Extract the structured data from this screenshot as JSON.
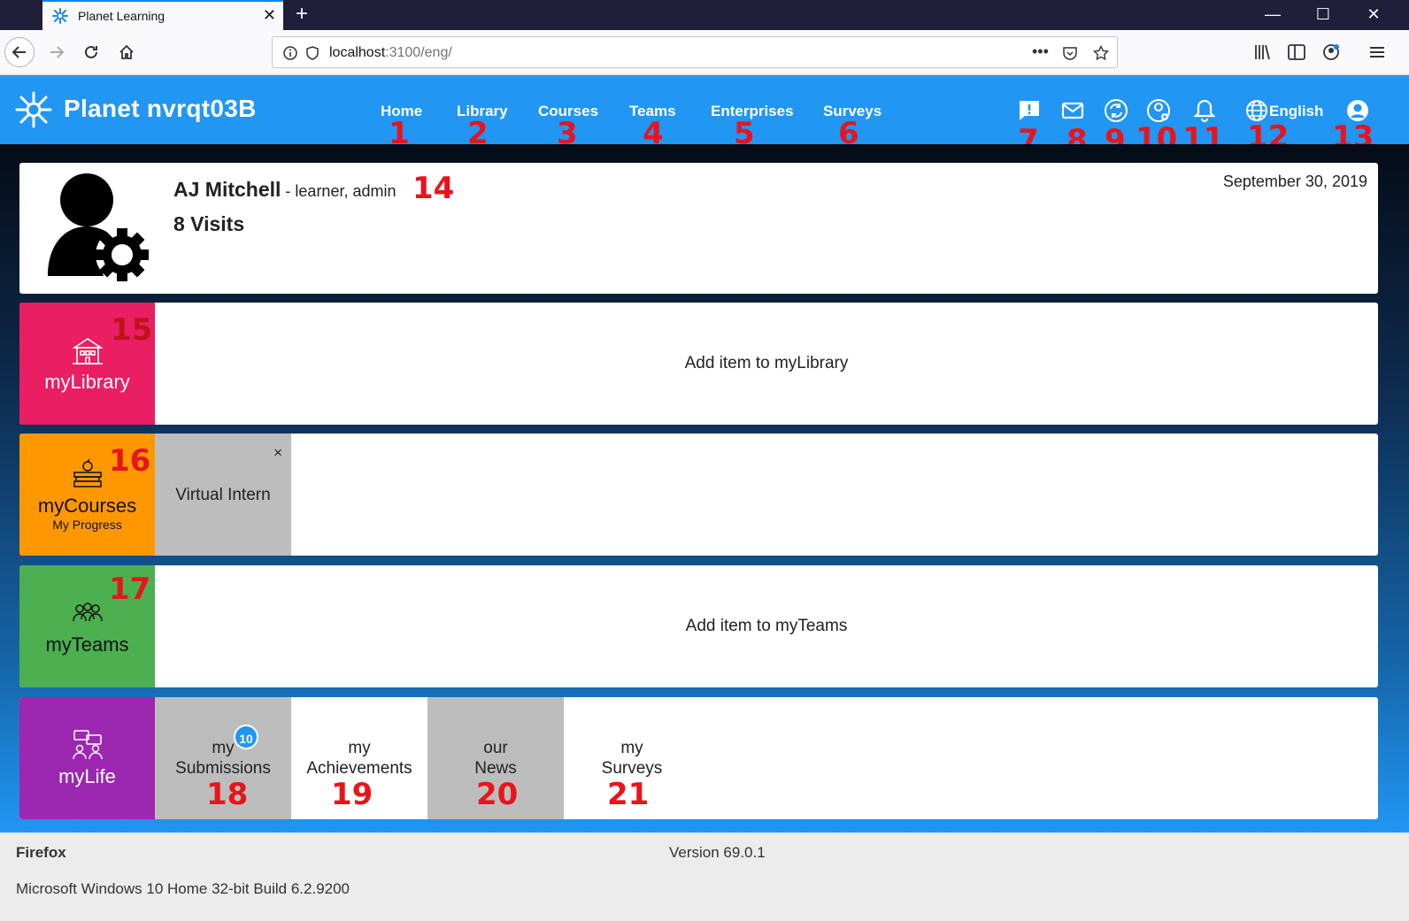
{
  "browser": {
    "tab_title": "Planet Learning",
    "url_host": "localhost",
    "url_rest": ":3100/eng/",
    "new_tab_label": "+",
    "tab_close_label": "✕"
  },
  "app": {
    "title": "Planet nvrqt03B",
    "nav": [
      {
        "label": "Home",
        "marker": "1"
      },
      {
        "label": "Library",
        "marker": "2"
      },
      {
        "label": "Courses",
        "marker": "3"
      },
      {
        "label": "Teams",
        "marker": "4"
      },
      {
        "label": "Enterprises",
        "marker": "5"
      },
      {
        "label": "Surveys",
        "marker": "6"
      }
    ],
    "icon_markers": [
      "7",
      "8",
      "9",
      "10",
      "11",
      "12",
      "13"
    ],
    "language": "English"
  },
  "profile": {
    "name": "AJ Mitchell",
    "roles": " - learner, admin",
    "visits": "8 Visits",
    "date": "September 30, 2019",
    "marker": "14"
  },
  "sections": {
    "library": {
      "label": "myLibrary",
      "empty": "Add item to myLibrary",
      "marker": "15",
      "color": "#e91e63"
    },
    "courses": {
      "label": "myCourses",
      "sub": "My Progress",
      "marker": "16",
      "color": "#ff9800",
      "items": [
        {
          "title": "Virtual Intern",
          "close": "×"
        }
      ]
    },
    "teams": {
      "label": "myTeams",
      "empty": "Add item to myTeams",
      "marker": "17",
      "color": "#4caf50"
    },
    "life": {
      "label": "myLife",
      "color": "#9c27b0",
      "items": [
        {
          "line1": "my",
          "line2": "Submissions",
          "marker": "18",
          "badge": "10"
        },
        {
          "line1": "my",
          "line2": "Achievements",
          "marker": "19"
        },
        {
          "line1": "our",
          "line2": "News",
          "marker": "20"
        },
        {
          "line1": "my",
          "line2": "Surveys",
          "marker": "21"
        }
      ]
    }
  },
  "footer": {
    "browser": "Firefox",
    "version": "Version 69.0.1",
    "os": "Microsoft Windows 10 Home 32-bit Build 6.2.9200"
  },
  "colors": {
    "appbar": "#2196f3",
    "marker": "#e8141c"
  }
}
